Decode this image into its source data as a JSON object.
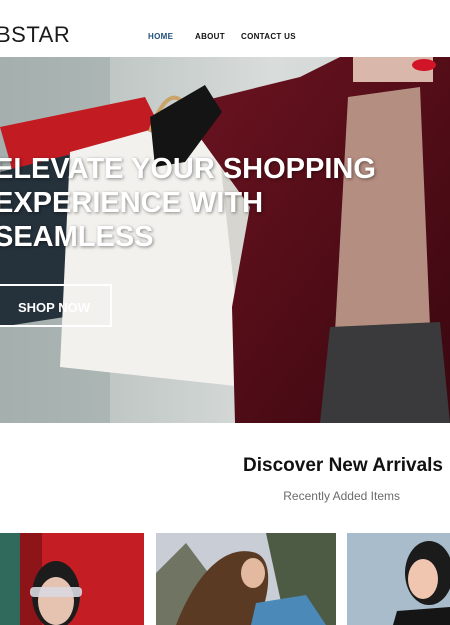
{
  "header": {
    "logo": "BSTAR",
    "nav": [
      {
        "label": "HOME",
        "active": true
      },
      {
        "label": "ABOUT"
      },
      {
        "label": "CONTACT US"
      }
    ]
  },
  "hero": {
    "title_lines": [
      "ELEVATE YOUR SHOPPING",
      "EXPERIENCE WITH",
      "SEAMLESS"
    ],
    "cta_label": "SHOP NOW"
  },
  "arrivals": {
    "title": "Discover New Arrivals",
    "subtitle": "Recently Added Items",
    "cards": [
      {
        "image": "woman-with-sunglasses-photo"
      },
      {
        "image": "woman-hair-flip-photo"
      },
      {
        "image": "smiling-woman-photo"
      }
    ]
  },
  "colors": {
    "nav_active": "#1f4e79",
    "coat": "#5e0f1a",
    "text_dark": "#111111"
  }
}
